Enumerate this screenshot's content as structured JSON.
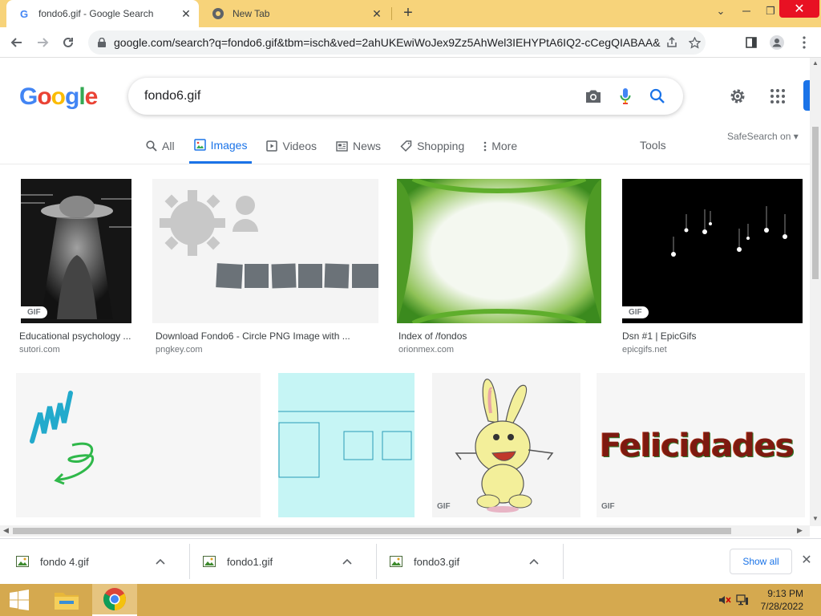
{
  "browser": {
    "tabs": [
      {
        "title": "fondo6.gif - Google Search",
        "favicon": "google-g-icon"
      },
      {
        "title": "New Tab",
        "favicon": "chrome-icon"
      }
    ],
    "new_tab": "+",
    "window_controls": {
      "minimize": "⌄",
      "restore": "❐",
      "close": "✕"
    },
    "url": "google.com/search?q=fondo6.gif&tbm=isch&ved=2ahUKEwiWoJex9Zz5AhWel3IEHYPtA6IQ2-cCegQIABAA&oq..."
  },
  "google": {
    "logo_letters": [
      {
        "ch": "G",
        "color": "#4285F4"
      },
      {
        "ch": "o",
        "color": "#EA4335"
      },
      {
        "ch": "o",
        "color": "#FBBC05"
      },
      {
        "ch": "g",
        "color": "#4285F4"
      },
      {
        "ch": "l",
        "color": "#34A853"
      },
      {
        "ch": "e",
        "color": "#EA4335"
      }
    ],
    "query": "fondo6.gif",
    "tabs": [
      {
        "label": "All",
        "icon": "search-icon"
      },
      {
        "label": "Images",
        "icon": "image-icon",
        "selected": true
      },
      {
        "label": "Videos",
        "icon": "video-icon"
      },
      {
        "label": "News",
        "icon": "news-icon"
      },
      {
        "label": "Shopping",
        "icon": "tag-icon"
      },
      {
        "label": "More",
        "icon": "more-vert-icon"
      }
    ],
    "tools": "Tools",
    "safesearch": "SafeSearch on ▾"
  },
  "results": [
    {
      "title": "Educational psychology ...",
      "source": "sutori.com",
      "badge": "GIF"
    },
    {
      "title": "Download Fondo6 - Circle PNG Image with ...",
      "source": "pngkey.com"
    },
    {
      "title": "Index of /fondos",
      "source": "orionmex.com"
    },
    {
      "title": "Dsn #1 | EpicGifs",
      "source": "epicgifs.net",
      "badge": "GIF"
    },
    {
      "badge": ""
    },
    {
      "badge": ""
    },
    {
      "badge": "GIF"
    },
    {
      "badge": "GIF",
      "text": "Felicidades"
    }
  ],
  "downloads": {
    "items": [
      "fondo 4.gif",
      "fondo1.gif",
      "fondo3.gif"
    ],
    "show_all": "Show all"
  },
  "taskbar": {
    "time": "9:13 PM",
    "date": "7/28/2022"
  },
  "colors": {
    "title_bar": "#f7d37a",
    "taskbar": "#d5a94f",
    "accent": "#1a73e8"
  }
}
